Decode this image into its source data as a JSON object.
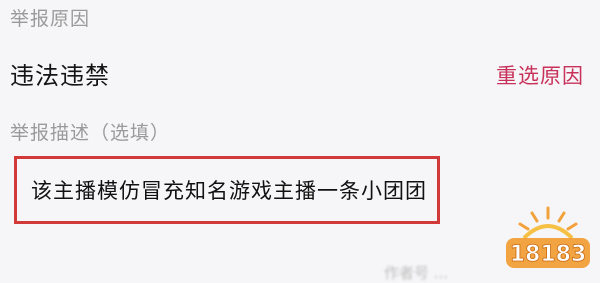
{
  "report_reason": {
    "label": "举报原因",
    "value": "违法违禁",
    "reselect_label": "重选原因"
  },
  "report_description": {
    "label": "举报描述（选填）",
    "text": "该主播模仿冒充知名游戏主播一条小团团"
  },
  "footer": {
    "blurred_text": "作者号 ..."
  },
  "watermark": {
    "text": "18183"
  },
  "colors": {
    "accent": "#c8325a",
    "highlight_border": "#d23a3a",
    "label_gray": "#9a9a9a",
    "background": "#f6f6f8"
  }
}
